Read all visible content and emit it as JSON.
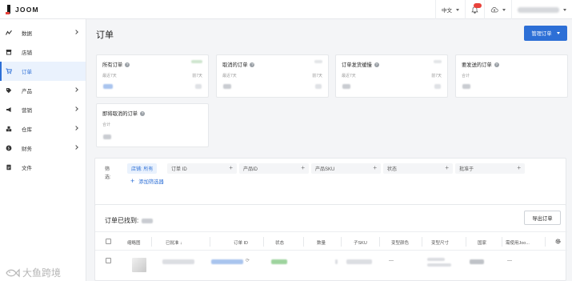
{
  "app": {
    "brand": "JOOM"
  },
  "topbar": {
    "language": "中文"
  },
  "sidebar": {
    "items": [
      {
        "label": "数据",
        "icon": "trend-icon",
        "has_children": true,
        "active": false
      },
      {
        "label": "店铺",
        "icon": "store-icon",
        "has_children": false,
        "active": false
      },
      {
        "label": "订单",
        "icon": "cart-icon",
        "has_children": false,
        "active": true
      },
      {
        "label": "产品",
        "icon": "tag-icon",
        "has_children": true,
        "active": false
      },
      {
        "label": "营销",
        "icon": "megaphone-icon",
        "has_children": true,
        "active": false
      },
      {
        "label": "仓库",
        "icon": "boxes-icon",
        "has_children": true,
        "active": false
      },
      {
        "label": "财务",
        "icon": "coin-icon",
        "has_children": true,
        "active": false
      },
      {
        "label": "文件",
        "icon": "document-icon",
        "has_children": false,
        "active": false
      }
    ]
  },
  "page": {
    "title": "订单",
    "manage_button": "管理订单"
  },
  "cards": [
    {
      "title": "所有订单",
      "left_sub": "最近7天",
      "right_sub": "前7天"
    },
    {
      "title": "取消的订单",
      "left_sub": "最近7天",
      "right_sub": "前7天"
    },
    {
      "title": "订单发货缓慢",
      "left_sub": "最近7天",
      "right_sub": "前7天"
    },
    {
      "title": "要发送的订单",
      "left_sub": "合计",
      "right_sub": ""
    },
    {
      "title": "即将取消的订单",
      "left_sub": "合计",
      "right_sub": ""
    }
  ],
  "filters": {
    "label": "筛选:",
    "store_chip": "店铺: 所有",
    "chips": [
      "订单 ID",
      "产品ID",
      "产品SKU",
      "状态",
      "批准于"
    ],
    "add_filter": "添加筛选器"
  },
  "results": {
    "found_label": "订单已找到:",
    "export_button": "导出订单",
    "columns": [
      "缩略图",
      "已批准",
      "订单 ID",
      "状态",
      "数量",
      "子SKU",
      "变型颜色",
      "变型尺寸",
      "国家",
      "需使用Joo..."
    ],
    "rows": [
      {
        "color": "—",
        "country": "—"
      }
    ]
  },
  "colors": {
    "accent": "#2d6fd6",
    "badge": "#e8423b",
    "link_blur": "#a9c4ee",
    "status_blur": "#9ed39e"
  },
  "watermark": {
    "text": "大鱼跨境"
  }
}
